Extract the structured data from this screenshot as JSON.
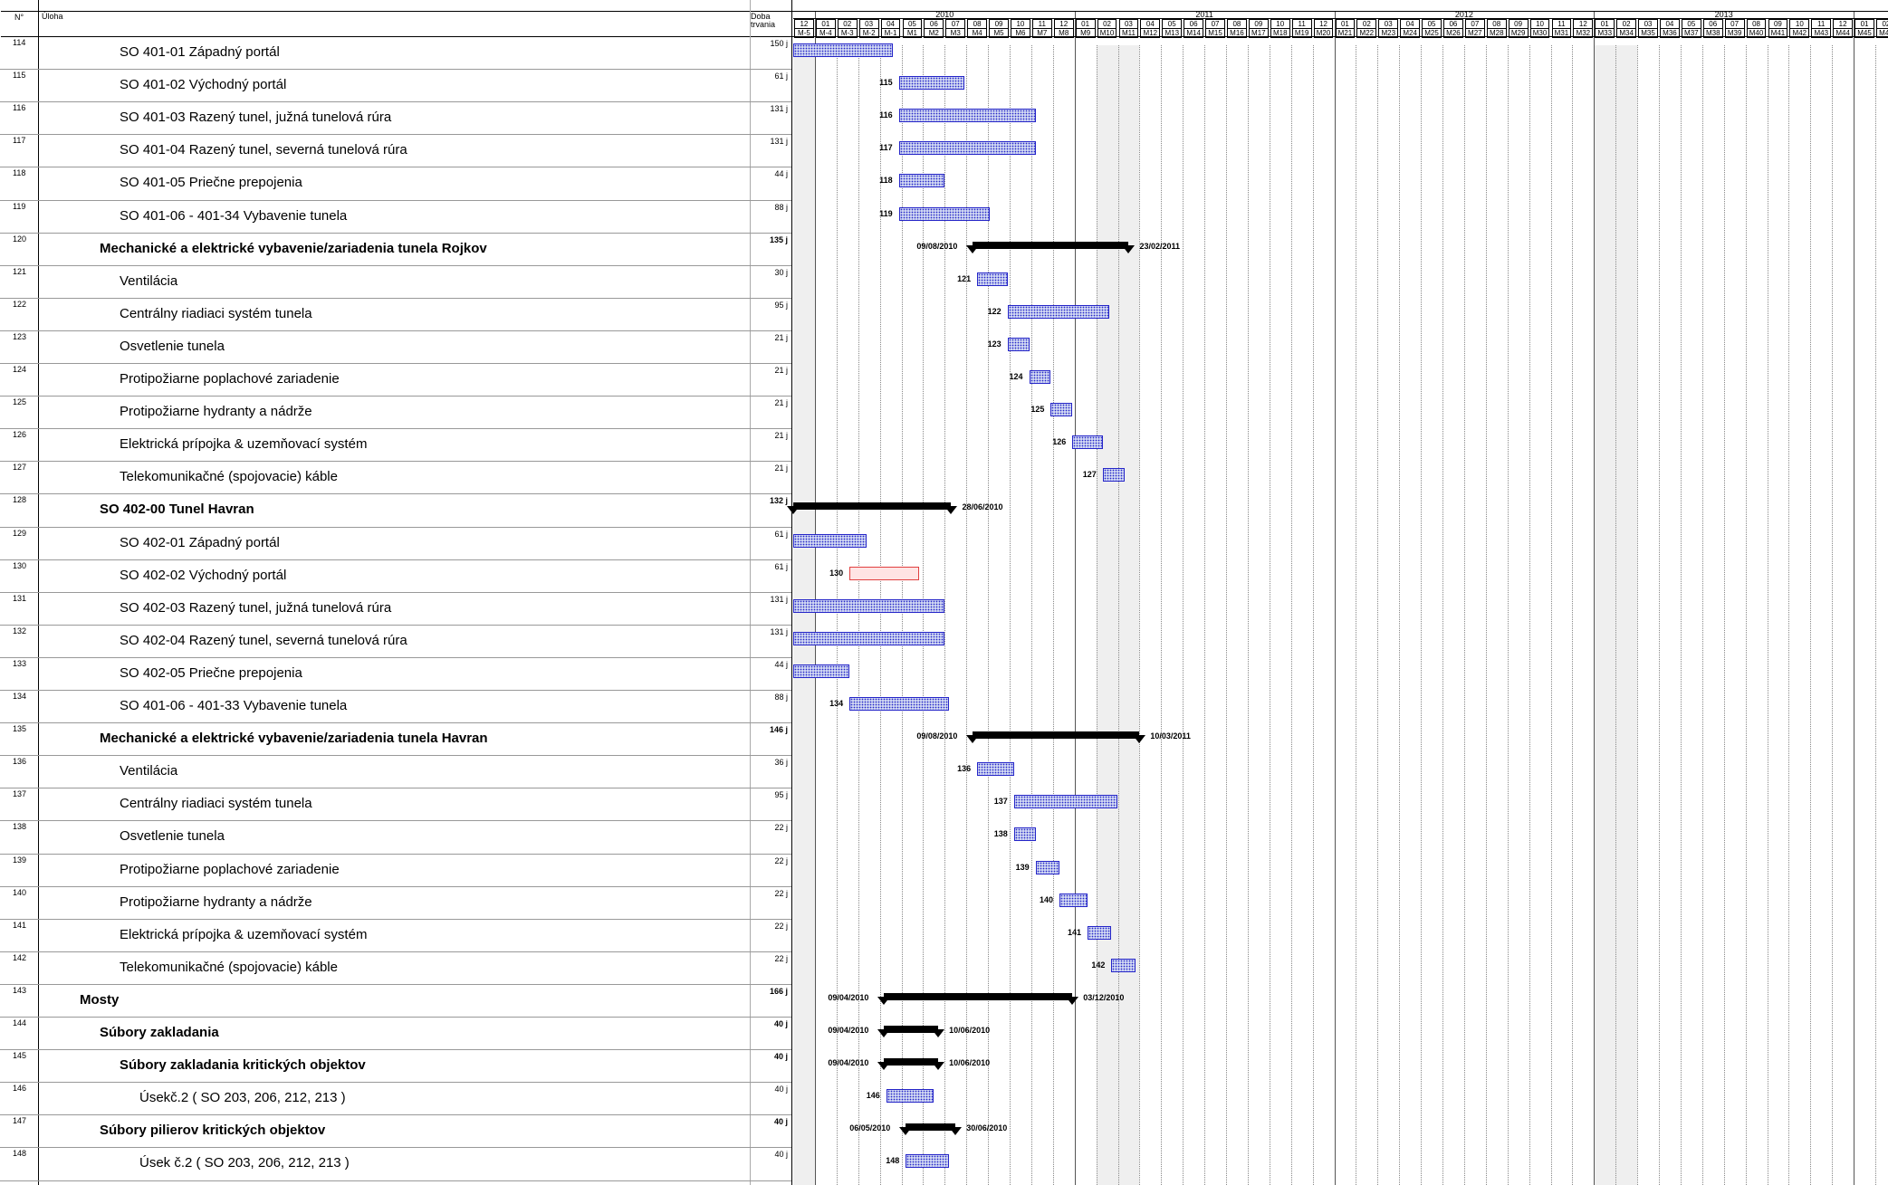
{
  "header": {
    "col_no": "N°",
    "col_task": "Úloha",
    "col_duration_line1": "Doba",
    "col_duration_line2": "trvania",
    "years": [
      "2010",
      "2011",
      "2012",
      "2013"
    ],
    "months": [
      "12",
      "01",
      "02",
      "03",
      "04",
      "05",
      "06",
      "07",
      "08",
      "09",
      "10",
      "11",
      "12",
      "01",
      "02",
      "03",
      "04",
      "05",
      "06",
      "07",
      "08",
      "09",
      "10",
      "11",
      "12",
      "01",
      "02",
      "03",
      "04",
      "05",
      "06",
      "07",
      "08",
      "09",
      "10",
      "11",
      "12",
      "01",
      "02",
      "03",
      "04",
      "05",
      "06",
      "07",
      "08",
      "09",
      "10",
      "11",
      "12",
      "01",
      "02"
    ],
    "milestones": [
      "M-5",
      "M-4",
      "M-3",
      "M-2",
      "M-1",
      "M1",
      "M2",
      "M3",
      "M4",
      "M5",
      "M6",
      "M7",
      "M8",
      "M9",
      "M10",
      "M11",
      "M12",
      "M13",
      "M14",
      "M15",
      "M16",
      "M17",
      "M18",
      "M19",
      "M20",
      "M21",
      "M22",
      "M23",
      "M24",
      "M25",
      "M26",
      "M27",
      "M28",
      "M29",
      "M30",
      "M31",
      "M32",
      "M33",
      "M34",
      "M35",
      "M36",
      "M37",
      "M38",
      "M39",
      "M40",
      "M41",
      "M42",
      "M43",
      "M44",
      "M45",
      "M46"
    ]
  },
  "rows": [
    {
      "id": "114",
      "name": "SO 401-01 Západný portál",
      "duration": "150 j",
      "level": "lvl2",
      "bar": {
        "kind": "task",
        "start_month": 0.0,
        "end_month": 4.6
      }
    },
    {
      "id": "115",
      "name": "SO 401-02 Východný portál",
      "duration": "61 j",
      "level": "lvl2",
      "bar": {
        "kind": "task",
        "start_month": 4.9,
        "end_month": 7.9,
        "label": "115"
      }
    },
    {
      "id": "116",
      "name": "SO 401-03 Razený tunel, južná tunelová rúra",
      "duration": "131 j",
      "level": "lvl2",
      "bar": {
        "kind": "task",
        "start_month": 4.9,
        "end_month": 11.2,
        "label": "116"
      }
    },
    {
      "id": "117",
      "name": "SO 401-04 Razený tunel, severná tunelová rúra",
      "duration": "131 j",
      "level": "lvl2",
      "bar": {
        "kind": "task",
        "start_month": 4.9,
        "end_month": 11.2,
        "label": "117"
      }
    },
    {
      "id": "118",
      "name": "SO 401-05 Priečne prepojenia",
      "duration": "44 j",
      "level": "lvl2",
      "bar": {
        "kind": "task",
        "start_month": 4.9,
        "end_month": 7.0,
        "label": "118"
      }
    },
    {
      "id": "119",
      "name": "SO 401-06 - 401-34 Vybavenie tunela",
      "duration": "88 j",
      "level": "lvl2",
      "bar": {
        "kind": "task",
        "start_month": 4.9,
        "end_month": 9.1,
        "label": "119"
      }
    },
    {
      "id": "120",
      "name": "Mechanické a elektrické vybavenie/zariadenia tunela Rojkov",
      "duration": "135 j",
      "level": "lvl1",
      "bar": {
        "kind": "summary",
        "start_month": 8.3,
        "end_month": 15.5,
        "start_label": "09/08/2010",
        "end_label": "23/02/2011"
      }
    },
    {
      "id": "121",
      "name": "Ventilácia",
      "duration": "30 j",
      "level": "lvl2",
      "bar": {
        "kind": "task",
        "start_month": 8.5,
        "end_month": 9.9,
        "label": "121"
      }
    },
    {
      "id": "122",
      "name": "Centrálny riadiaci systém tunela",
      "duration": "95 j",
      "level": "lvl2",
      "bar": {
        "kind": "task",
        "start_month": 9.9,
        "end_month": 14.6,
        "label": "122"
      }
    },
    {
      "id": "123",
      "name": "Osvetlenie tunela",
      "duration": "21 j",
      "level": "lvl2",
      "bar": {
        "kind": "task",
        "start_month": 9.9,
        "end_month": 10.9,
        "label": "123"
      }
    },
    {
      "id": "124",
      "name": "Protipožiarne poplachové zariadenie",
      "duration": "21 j",
      "level": "lvl2",
      "bar": {
        "kind": "task",
        "start_month": 10.9,
        "end_month": 11.9,
        "label": "124"
      }
    },
    {
      "id": "125",
      "name": "Protipožiarne hydranty a nádrže",
      "duration": "21 j",
      "level": "lvl2",
      "bar": {
        "kind": "task",
        "start_month": 11.9,
        "end_month": 12.9,
        "label": "125"
      }
    },
    {
      "id": "126",
      "name": "Elektrická prípojka & uzemňovací systém",
      "duration": "21 j",
      "level": "lvl2",
      "bar": {
        "kind": "task",
        "start_month": 12.9,
        "end_month": 14.3,
        "label": "126"
      }
    },
    {
      "id": "127",
      "name": "Telekomunikačné (spojovacie) káble",
      "duration": "21 j",
      "level": "lvl2",
      "bar": {
        "kind": "task",
        "start_month": 14.3,
        "end_month": 15.3,
        "label": "127"
      }
    },
    {
      "id": "128",
      "name": "SO 402-00 Tunel Havran",
      "duration": "132 j",
      "level": "lvl1",
      "bar": {
        "kind": "summary",
        "start_month": 0.0,
        "end_month": 7.3,
        "end_label": "28/06/2010"
      }
    },
    {
      "id": "129",
      "name": "SO 402-01 Západný portál",
      "duration": "61 j",
      "level": "lvl2",
      "bar": {
        "kind": "task",
        "start_month": 0.0,
        "end_month": 3.4
      }
    },
    {
      "id": "130",
      "name": "SO 402-02 Východný portál",
      "duration": "61 j",
      "level": "lvl2",
      "bar": {
        "kind": "task",
        "red": true,
        "start_month": 2.6,
        "end_month": 5.8,
        "label": "130"
      }
    },
    {
      "id": "131",
      "name": "SO 402-03 Razený tunel, južná tunelová rúra",
      "duration": "131 j",
      "level": "lvl2",
      "bar": {
        "kind": "task",
        "start_month": 0.0,
        "end_month": 7.0
      }
    },
    {
      "id": "132",
      "name": "SO 402-04 Razený tunel, severná tunelová rúra",
      "duration": "131 j",
      "level": "lvl2",
      "bar": {
        "kind": "task",
        "start_month": 0.0,
        "end_month": 7.0
      }
    },
    {
      "id": "133",
      "name": "SO 402-05 Priečne prepojenia",
      "duration": "44 j",
      "level": "lvl2",
      "bar": {
        "kind": "task",
        "start_month": 0.0,
        "end_month": 2.6
      }
    },
    {
      "id": "134",
      "name": "SO 401-06 - 401-33 Vybavenie tunela",
      "duration": "88 j",
      "level": "lvl2",
      "bar": {
        "kind": "task",
        "start_month": 2.6,
        "end_month": 7.2,
        "label": "134"
      }
    },
    {
      "id": "135",
      "name": "Mechanické a elektrické vybavenie/zariadenia tunela Havran",
      "duration": "146 j",
      "level": "lvl1",
      "bar": {
        "kind": "summary",
        "start_month": 8.3,
        "end_month": 16.0,
        "start_label": "09/08/2010",
        "end_label": "10/03/2011"
      }
    },
    {
      "id": "136",
      "name": "Ventilácia",
      "duration": "36 j",
      "level": "lvl2",
      "bar": {
        "kind": "task",
        "start_month": 8.5,
        "end_month": 10.2,
        "label": "136"
      }
    },
    {
      "id": "137",
      "name": "Centrálny riadiaci systém tunela",
      "duration": "95 j",
      "level": "lvl2",
      "bar": {
        "kind": "task",
        "start_month": 10.2,
        "end_month": 15.0,
        "label": "137"
      }
    },
    {
      "id": "138",
      "name": "Osvetlenie tunela",
      "duration": "22 j",
      "level": "lvl2",
      "bar": {
        "kind": "task",
        "start_month": 10.2,
        "end_month": 11.2,
        "label": "138"
      }
    },
    {
      "id": "139",
      "name": "Protipožiarne poplachové zariadenie",
      "duration": "22 j",
      "level": "lvl2",
      "bar": {
        "kind": "task",
        "start_month": 11.2,
        "end_month": 12.3,
        "label": "139"
      }
    },
    {
      "id": "140",
      "name": "Protipožiarne hydranty a nádrže",
      "duration": "22 j",
      "level": "lvl2",
      "bar": {
        "kind": "task",
        "start_month": 12.3,
        "end_month": 13.6,
        "label": "140"
      }
    },
    {
      "id": "141",
      "name": "Elektrická prípojka & uzemňovací systém",
      "duration": "22 j",
      "level": "lvl2",
      "bar": {
        "kind": "task",
        "start_month": 13.6,
        "end_month": 14.7,
        "label": "141"
      }
    },
    {
      "id": "142",
      "name": "Telekomunikačné (spojovacie) káble",
      "duration": "22 j",
      "level": "lvl2",
      "bar": {
        "kind": "task",
        "start_month": 14.7,
        "end_month": 15.8,
        "label": "142"
      }
    },
    {
      "id": "143",
      "name": "Mosty",
      "duration": "166 j",
      "level": "lvl0",
      "bar": {
        "kind": "summary",
        "start_month": 4.2,
        "end_month": 12.9,
        "start_label": "09/04/2010",
        "end_label": "03/12/2010"
      }
    },
    {
      "id": "144",
      "name": "Súbory zakladania",
      "duration": "40 j",
      "level": "lvl1",
      "bar": {
        "kind": "summary",
        "start_month": 4.2,
        "end_month": 6.7,
        "start_label": "09/04/2010",
        "end_label": "10/06/2010"
      }
    },
    {
      "id": "145",
      "name": "Súbory zakladania kritických objektov",
      "duration": "40 j",
      "level": "lvl2b",
      "bar": {
        "kind": "summary",
        "start_month": 4.2,
        "end_month": 6.7,
        "start_label": "09/04/2010",
        "end_label": "10/06/2010"
      }
    },
    {
      "id": "146",
      "name": "Úsekč.2 ( SO 203, 206, 212, 213 )",
      "duration": "40 j",
      "level": "lvl3",
      "bar": {
        "kind": "task",
        "start_month": 4.3,
        "end_month": 6.5,
        "label": "146"
      }
    },
    {
      "id": "147",
      "name": "Súbory pilierov kritických objektov",
      "duration": "40 j",
      "level": "lvl1",
      "bar": {
        "kind": "summary",
        "start_month": 5.2,
        "end_month": 7.5,
        "start_label": "06/05/2010",
        "end_label": "30/06/2010"
      }
    },
    {
      "id": "148",
      "name": "Úsek č.2 ( SO 203, 206, 212, 213 )",
      "duration": "40 j",
      "level": "lvl3",
      "bar": {
        "kind": "task",
        "start_month": 5.2,
        "end_month": 7.2,
        "label": "148"
      }
    }
  ]
}
